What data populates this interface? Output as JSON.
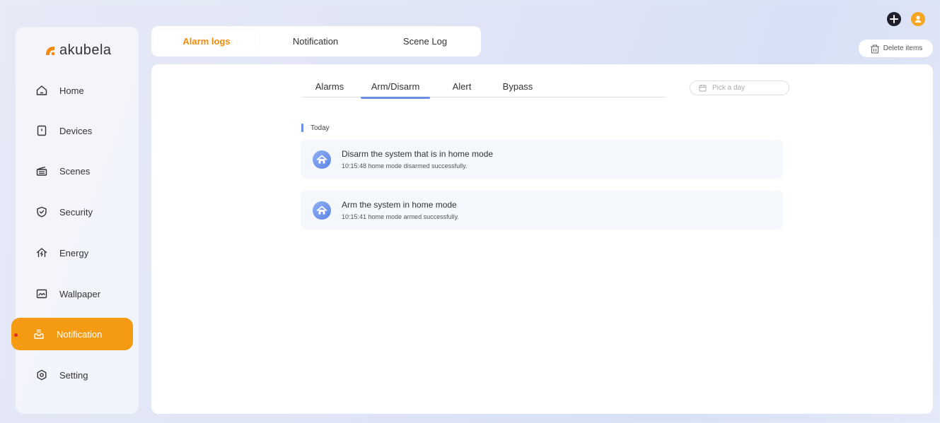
{
  "brand": {
    "name": "akubela",
    "color": "#f28a0c"
  },
  "sidebar": {
    "items": [
      {
        "label": "Home",
        "icon": "home-icon",
        "active": false
      },
      {
        "label": "Devices",
        "icon": "devices-icon",
        "active": false
      },
      {
        "label": "Scenes",
        "icon": "scenes-icon",
        "active": false
      },
      {
        "label": "Security",
        "icon": "shield-icon",
        "active": false
      },
      {
        "label": "Energy",
        "icon": "energy-icon",
        "active": false
      },
      {
        "label": "Wallpaper",
        "icon": "wallpaper-icon",
        "active": false
      },
      {
        "label": "Notification",
        "icon": "notification-icon",
        "active": true
      },
      {
        "label": "Setting",
        "icon": "setting-icon",
        "active": false
      }
    ]
  },
  "tabs": [
    {
      "label": "Alarm logs",
      "active": true
    },
    {
      "label": "Notification",
      "active": false
    },
    {
      "label": "Scene Log",
      "active": false
    }
  ],
  "toolbar": {
    "delete_label": "Delete items"
  },
  "subtabs": [
    {
      "label": "Alarms",
      "active": false
    },
    {
      "label": "Arm/Disarm",
      "active": true
    },
    {
      "label": "Alert",
      "active": false
    },
    {
      "label": "Bypass",
      "active": false
    }
  ],
  "datepicker": {
    "placeholder": "Pick a day"
  },
  "section": {
    "label": "Today"
  },
  "logs": [
    {
      "title": "Disarm the system that is in home mode",
      "detail": "10:15:48 home mode disarmed successfully."
    },
    {
      "title": "Arm the system in home mode",
      "detail": "10:15:41 home mode armed successfully."
    }
  ],
  "colors": {
    "accent": "#f59a13",
    "highlight": "#6d8ee8",
    "alert_dot": "#e0301e"
  }
}
